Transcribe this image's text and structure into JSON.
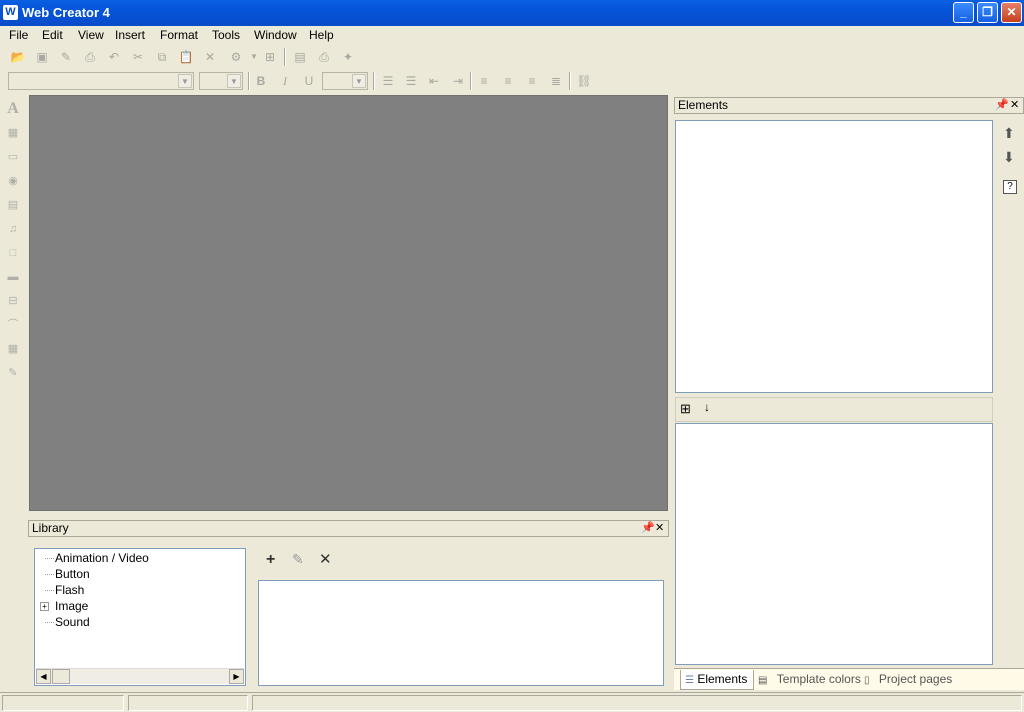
{
  "window": {
    "title": "Web Creator 4",
    "app_icon": "W"
  },
  "menu": [
    "File",
    "Edit",
    "View",
    "Insert",
    "Format",
    "Tools",
    "Window",
    "Help"
  ],
  "elements_panel": {
    "title": "Elements"
  },
  "library_panel": {
    "title": "Library",
    "tree": [
      "Animation / Video",
      "Button",
      "Flash",
      "Image",
      "Sound"
    ]
  },
  "bottom_tabs": [
    "Elements",
    "Template colors",
    "Project pages"
  ],
  "format_buttons": {
    "bold": "B",
    "italic": "I",
    "underline": "U"
  }
}
